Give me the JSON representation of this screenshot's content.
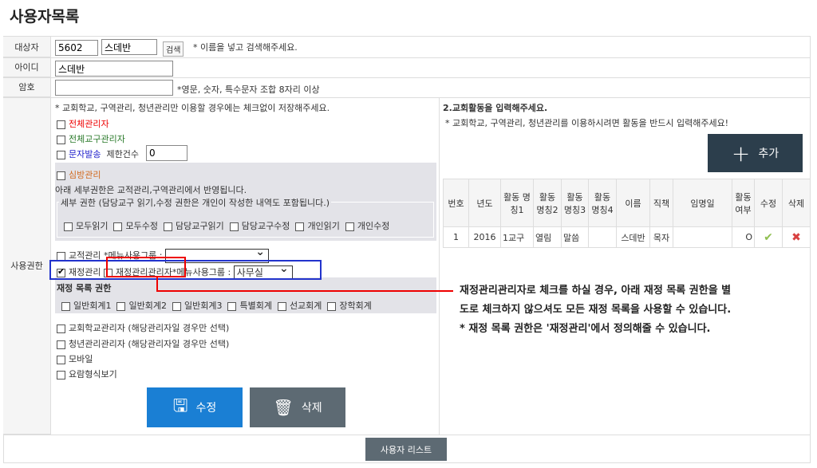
{
  "title": "사용자목록",
  "labels": {
    "target": "대상자",
    "id": "아이디",
    "password": "암호",
    "permission": "사용권한"
  },
  "target": {
    "code": "5602",
    "name": "스데반",
    "search": "검색",
    "hint": "* 이름을 넣고 검색해주세요."
  },
  "id_value": "스데반",
  "password": {
    "value": "",
    "hint": "*영문, 숫자, 특수문자 조합 8자리 이상"
  },
  "perm": {
    "note": "* 교회학교, 구역관리, 청년관리만 이용할 경우에는 체크없이 저장해주세요.",
    "all_admin": "전체관리자",
    "all_parish_admin": "전체교구관리자",
    "sms": "문자발송",
    "limit_label": "제한건수",
    "limit_value": "0",
    "visit": "심방관리",
    "visit_note": "아래 세부권한은 교적관리,구역관리에서 반영됩니다.",
    "detail_legend": "세부 권한 (담당교구 읽기,수정 권한은 개인이 작성한 내역도 포함됩니다.)",
    "detail": [
      "모두읽기",
      "모두수정",
      "담당교구읽기",
      "담당교구수정",
      "개인읽기",
      "개인수정"
    ],
    "registry": "교적관리",
    "menu_group_label": "*메뉴사용그룹 :",
    "registry_group": "",
    "finance": "재정관리",
    "finance_admin": "재정관리관리자",
    "finance_group": "사무실",
    "finance_list_title": "재정 목록 권한",
    "finance_list": [
      "일반회계1",
      "일반회계2",
      "일반회계3",
      "특별회계",
      "선교회계",
      "장학회계"
    ],
    "others": [
      "교회학교관리자 (해당관리자일 경우만 선택)",
      "청년관리관리자 (해당관리자일 경우만 선택)",
      "모바일",
      "요람형식보기"
    ],
    "save": "수정",
    "delete": "삭제"
  },
  "activity": {
    "title": "2.교회활동을 입력해주세요.",
    "note": "* 교회학교, 구역관리, 청년관리를 이용하시려면 활동을 반드시 입력해주세요!",
    "add": "추가",
    "headers": [
      "번호",
      "년도",
      "활동 명칭1",
      "활동 명칭2",
      "활동 명칭3",
      "활동 명칭4",
      "이름",
      "직책",
      "임명일",
      "활동 여부",
      "수정",
      "삭제"
    ],
    "rows": [
      [
        "1",
        "2016",
        "1교구",
        "열림",
        "말씀",
        "",
        "스데반",
        "목자",
        "",
        "O"
      ]
    ]
  },
  "annotation": [
    "재정관리관리자로 체크를 하실 경우, 아래 재정 목록 권한을 별",
    "도로 체크하지 않으셔도 모든 재정 목록을 사용할 수 있습니다.",
    "* 재정 목록 권한은 '재정관리'에서 정의해줄 수 있습니다."
  ],
  "user_list": "사용자 리스트",
  "colors": {
    "save": "#1a7fd4",
    "delete": "#5d6a73",
    "add": "#2c3e4c",
    "annot_red": "#e00000",
    "annot_blue": "#2233cc"
  }
}
